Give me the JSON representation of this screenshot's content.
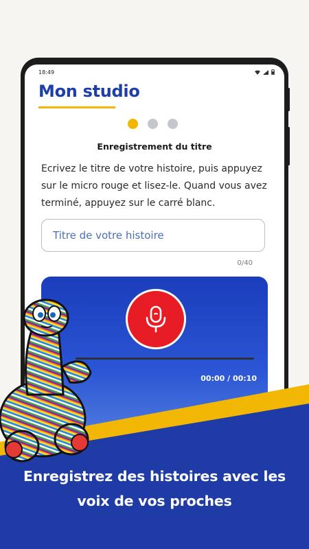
{
  "status_bar": {
    "time": "18:49"
  },
  "header": {
    "title": "Mon studio"
  },
  "steps": {
    "total": 3,
    "current": 1
  },
  "step_heading": "Enregistrement du titre",
  "instructions": "Ecrivez le titre de votre histoire, puis appuyez sur le micro rouge et lisez-le. Quand vous avez terminé, appuyez sur le carré blanc.",
  "title_field": {
    "placeholder": "Titre de votre histoire",
    "value": "",
    "counter": "0/40"
  },
  "recorder": {
    "time": "00:00 / 00:10",
    "progress": 0,
    "mic_icon": "microphone-icon"
  },
  "promo": {
    "tagline_line1": "Enregistrez des histoires avec les",
    "tagline_line2": "voix de vos proches"
  },
  "colors": {
    "brand_blue": "#1e3fa8",
    "accent_yellow": "#f2b705",
    "mic_red": "#e71c24",
    "promo_blue": "#1f3ca6"
  }
}
